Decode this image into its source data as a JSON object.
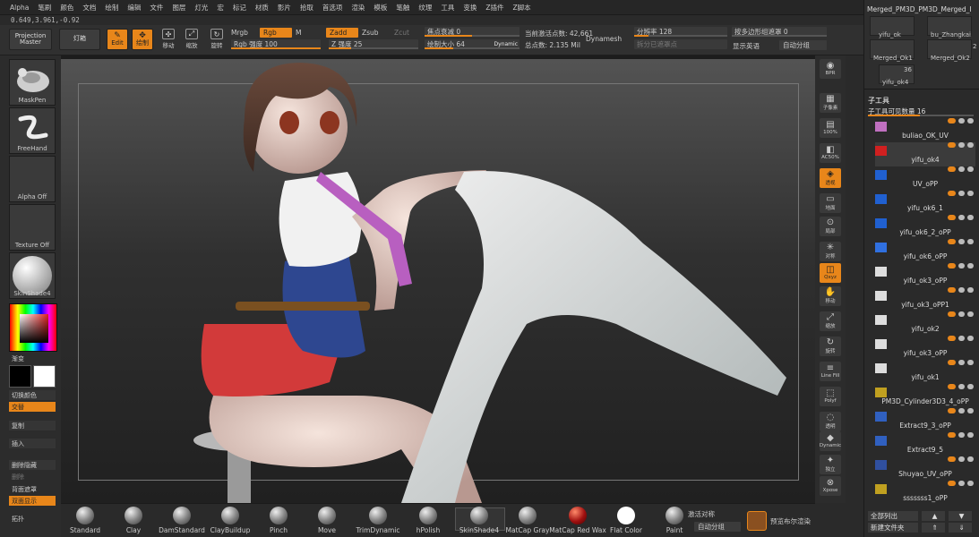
{
  "menu": [
    "Alpha",
    "笔刷",
    "颜色",
    "文档",
    "绘制",
    "编辑",
    "文件",
    "图层",
    "灯光",
    "宏",
    "标记",
    "材质",
    "影片",
    "拾取",
    "首选项",
    "渲染",
    "模板",
    "笔触",
    "纹理",
    "工具",
    "变换",
    "Z插件",
    "Z脚本"
  ],
  "coords": "0.649,3.961,-0.92",
  "toolbar": {
    "projection_master": "Projection Master",
    "lightbox": "灯箱",
    "edit": "Edit",
    "draw": "绘制",
    "move": "移动",
    "scale": "缩放",
    "rotate": "旋转",
    "mrgb": "Mrgb",
    "rgb": "Rgb",
    "m": "M",
    "zadd": "Zadd",
    "zsub": "Zsub",
    "zcut": "Zcut",
    "rgb_intensity": "Rgb 强度 100",
    "z_intensity": "Z 强度 25",
    "focal_shift": "焦点衰减 0",
    "draw_size": "绘制大小 64",
    "dynamic": "Dynamic",
    "active_points": "当前激活点数: 42,661",
    "total_points": "总点数: 2.135 Mil",
    "dynamesh": "Dynamesh",
    "divide_rate": "分辨率 128",
    "split_masked": "拆分已遮罩点",
    "group_polys": "按多边形组遮罩 0",
    "show_english": "显示英语",
    "auto_group": "自动分组"
  },
  "left": {
    "brush1": "MaskPen",
    "brush2": "FreeHand",
    "alpha": "Alpha Off",
    "texture": "Texture Off",
    "material": "SkinShade4",
    "gradient": "渐变",
    "switch_color": "切换颜色",
    "swap": "交替",
    "copy": "复制",
    "insert": "插入",
    "delete_hidden": "删除隐藏",
    "delete": "删除",
    "back_mask": "背面遮罩",
    "double": "双面显示",
    "topology": "拓扑"
  },
  "rightstrip": [
    "BPR",
    "子像素",
    "100%",
    "AC50%",
    "透视",
    "地面",
    "局部",
    "对称",
    "Qxyz",
    "移动",
    "缩放",
    "旋转",
    "Line Fill",
    "Polyf",
    "透明",
    "Dynamic",
    "独立",
    "Xpose"
  ],
  "subtool": {
    "top_title": "Merged_PM3D_PM3D_Merged_I",
    "top_items": [
      "yifu_ok",
      "bu_Zhangkai",
      "Merged_Ok1",
      "Merged_Ok2",
      "yifu_ok4"
    ],
    "top_counts": [
      "2",
      "36"
    ],
    "header": "子工具",
    "visible_count": "子工具可见数量 16",
    "items": [
      "buliao_OK_UV",
      "yifu_ok4",
      "UV_oPP",
      "yifu_ok6_1",
      "yifu_ok6_2_oPP",
      "yifu_ok6_oPP",
      "yifu_ok3_oPP",
      "yifu_ok3_oPP1",
      "yifu_ok2",
      "yifu_ok3_oPP",
      "yifu_ok1",
      "PM3D_Cylinder3D3_4_oPP",
      "Extract9_3_oPP",
      "Extract9_5",
      "Shuyao_UV_oPP",
      "sssssss1_oPP"
    ],
    "list_all": "全部列出",
    "new_folder": "新建文件夹"
  },
  "bottom": {
    "brushes": [
      "Standard",
      "Clay",
      "DamStandard",
      "ClayBuildup",
      "Pinch",
      "Move",
      "TrimDynamic",
      "hPolish",
      "SkinShade4",
      "MatCap Gray",
      "MatCap Red Wax",
      "Flat Color",
      "Paint"
    ],
    "activate_sym": "激活对称",
    "auto_group": "自动分组",
    "bpr_preview": "预览布尔渲染"
  },
  "colors": {
    "accent": "#e8861a"
  }
}
